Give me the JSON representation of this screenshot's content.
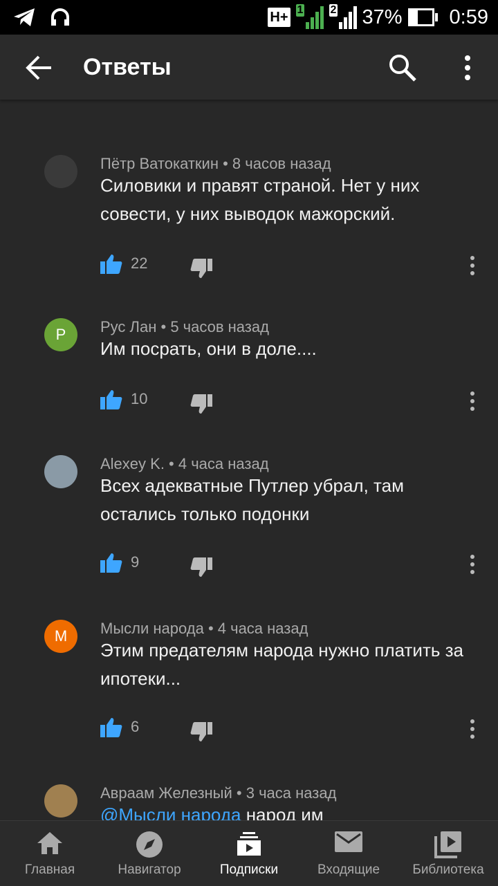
{
  "status_bar": {
    "network": "H+",
    "sim1": "1",
    "sim2": "2",
    "battery": "37%",
    "battery_level": 0.37,
    "time": "0:59"
  },
  "app_bar": {
    "title": "Ответы"
  },
  "comments": [
    {
      "author": "Пётр Ватокаткин",
      "time": "8 часов назад",
      "text": "Силовики и правят страной. Нет у них совести, у них выводок мажорский.",
      "likes": "22",
      "avatar_letter": "",
      "avatar_color": "#3a3a3a"
    },
    {
      "author": "Рус Лан",
      "time": "5 часов назад",
      "text": "Им посрать, они в доле....",
      "likes": "10",
      "avatar_letter": "Р",
      "avatar_color": "#6aa436"
    },
    {
      "author": "Alexey K.",
      "time": "4 часа назад",
      "text": "Всех адекватные Путлер убрал, там остались только подонки",
      "likes": "9",
      "avatar_letter": "",
      "avatar_color": "#8a9aa6"
    },
    {
      "author": "Мысли народа",
      "time": "4 часа назад",
      "text": "Этим предателям народа нужно платить за ипотеки...",
      "likes": "6",
      "avatar_letter": "М",
      "avatar_color": "#ef6c00"
    },
    {
      "author": "Авраам Железный",
      "time": "3 часа назад",
      "mention": "@Мысли народа",
      "text": " народ им",
      "avatar_letter": "",
      "avatar_color": "#a08050"
    }
  ],
  "bottom_nav": [
    {
      "label": "Главная",
      "icon": "home-icon"
    },
    {
      "label": "Навигатор",
      "icon": "compass-icon"
    },
    {
      "label": "Подписки",
      "icon": "subscriptions-icon",
      "active": true
    },
    {
      "label": "Входящие",
      "icon": "inbox-icon"
    },
    {
      "label": "Библиотека",
      "icon": "library-icon"
    }
  ],
  "colors": {
    "background": "#282828",
    "like_blue": "#3ea6ff",
    "secondary_text": "#aaaaaa"
  }
}
